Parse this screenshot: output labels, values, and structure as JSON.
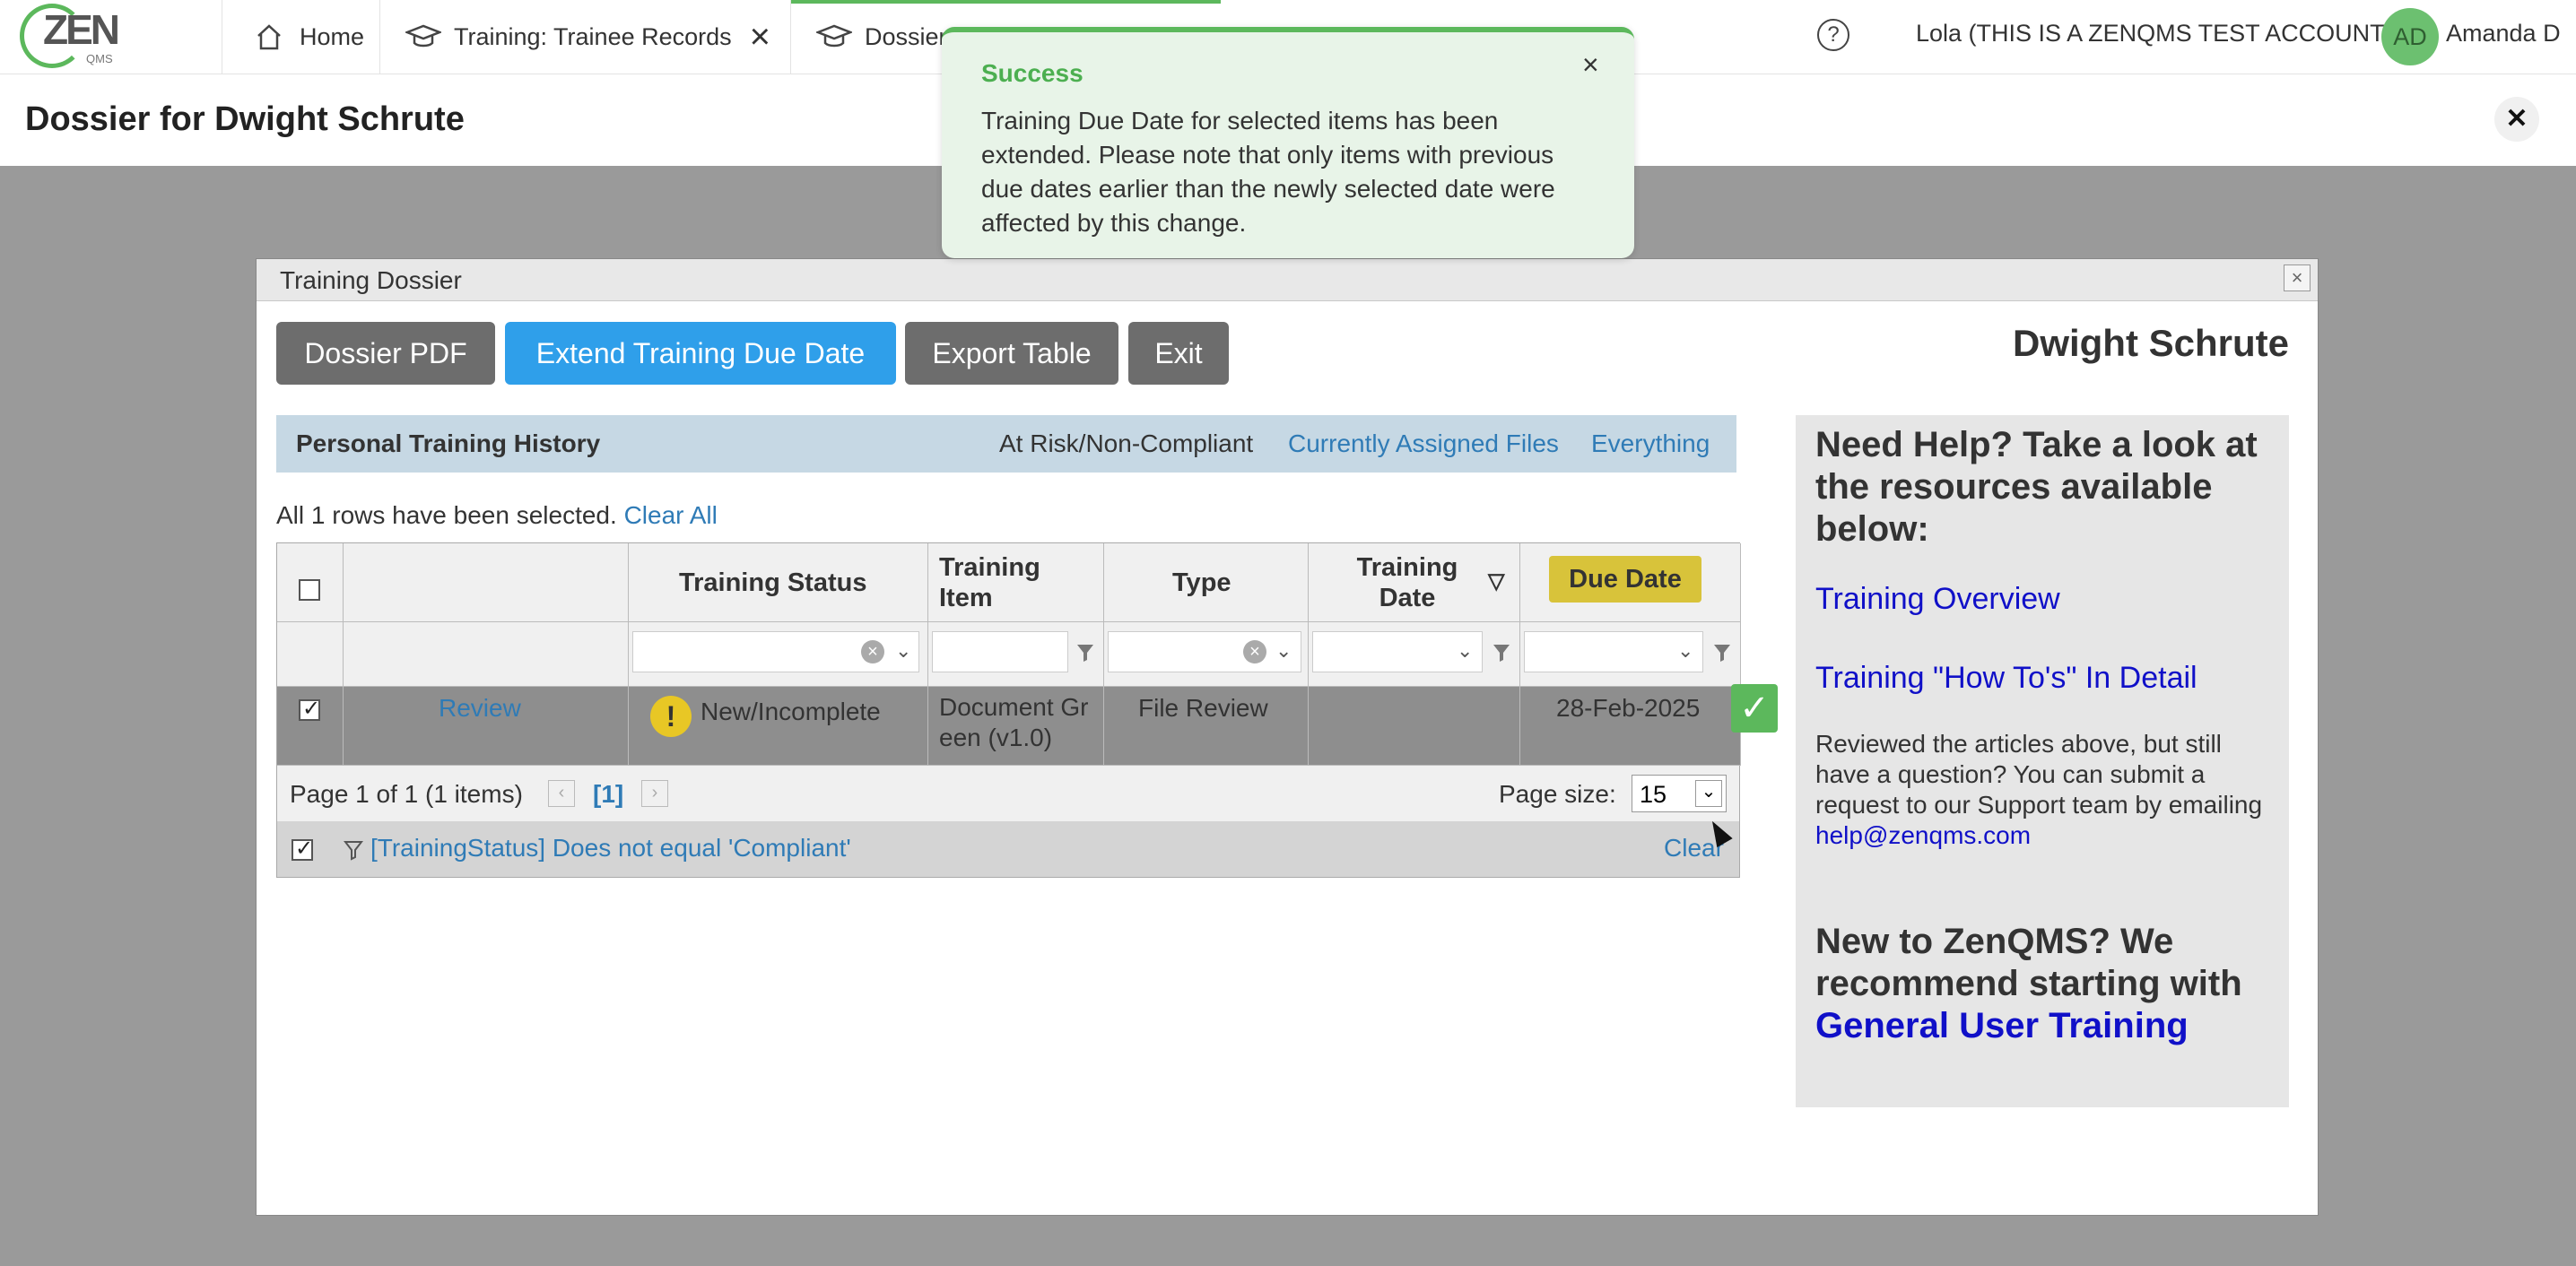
{
  "nav": {
    "tabs": [
      {
        "label": "Home"
      },
      {
        "label": "Training: Trainee Records"
      },
      {
        "label": "Dossier for Dwight Schrute"
      }
    ],
    "account_label": "Lola (THIS IS A ZENQMS TEST ACCOUNT)",
    "avatar_initials": "AD",
    "user_name": "Amanda D",
    "logo_text": "ZEN",
    "logo_sub": "QMS"
  },
  "page": {
    "title": "Dossier for Dwight  Schrute",
    "close_glyph": "✕"
  },
  "toast": {
    "title": "Success",
    "message": "Training Due Date for selected items has been extended. Please note that only items with previous due dates earlier than the newly selected date were affected by this change.",
    "close_glyph": "×"
  },
  "modal": {
    "title": "Training Dossier",
    "buttons": {
      "dossier_pdf": "Dossier PDF",
      "extend_due": "Extend Training Due Date",
      "export": "Export Table",
      "exit": "Exit"
    },
    "person_name": "Dwight Schrute",
    "history_title": "Personal Training History",
    "history_links": [
      "At Risk/Non-Compliant",
      "Currently Assigned Files",
      "Everything"
    ],
    "selection_msg": "All 1 rows have been selected.",
    "clear_all": "Clear All",
    "columns": [
      "Training Status",
      "Training Item",
      "Type",
      "Training Date",
      "Due Date"
    ],
    "rows": [
      {
        "action": "Review",
        "status": "New/Incomplete",
        "item": "Document Green (v1.0)",
        "type": "File Review",
        "training_date": "",
        "due_date": "28-Feb-2025"
      }
    ],
    "pager": {
      "info": "Page 1 of 1 (1 items)",
      "current": "[1]",
      "page_size_label": "Page size:",
      "page_size": "15"
    },
    "filter_expression": "[TrainingStatus] Does not equal 'Compliant'",
    "filter_clear": "Clear"
  },
  "help": {
    "heading": "Need Help? Take a look at the resources available below:",
    "link1": "Training Overview",
    "link2": "Training \"How To's\" In Detail",
    "para_text": "Reviewed the articles above, but still have a question? You can submit a request to our Support team by emailing",
    "email": "help@zenqms.com",
    "new_text": "New to ZenQMS? We recommend starting with",
    "new_link": "General User Training"
  },
  "colors": {
    "accent": "#2f9fea",
    "success": "#5cb85c",
    "due_badge": "#d8c33a"
  }
}
